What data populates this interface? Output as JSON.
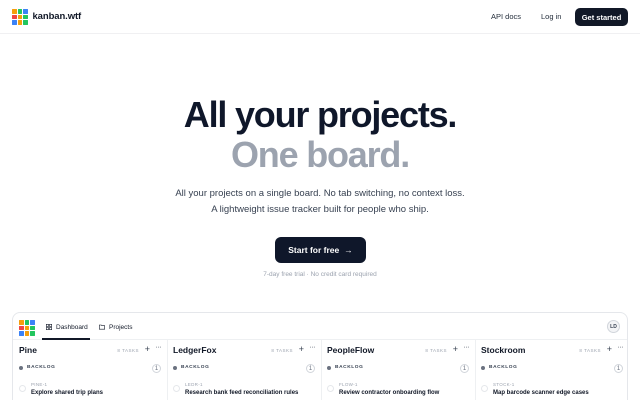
{
  "brand": {
    "name": "kanban.wtf",
    "logo_colors": [
      "#f59e0b",
      "#22c55e",
      "#3b82f6",
      "#ef4444",
      "#f59e0b",
      "#22c55e",
      "#3b82f6",
      "#f59e0b",
      "#22c55e"
    ]
  },
  "nav": {
    "api_docs": "API docs",
    "login": "Log in",
    "get_started": "Get started"
  },
  "hero": {
    "line1": "All your projects.",
    "line2": "One board.",
    "sub1": "All your projects on a single board. No tab switching, no context loss.",
    "sub2": "A lightweight issue tracker built for people who ship.",
    "cta_label": "Start for free",
    "cta_arrow": "→",
    "note": "7-day free trial · No credit card required"
  },
  "preview": {
    "tabs": [
      {
        "label": "Dashboard",
        "icon": "grid-icon"
      },
      {
        "label": "Projects",
        "icon": "folder-icon"
      }
    ],
    "avatar_initials": "LD",
    "columns": [
      {
        "title": "Pine",
        "count": "8 TASKS",
        "status": "BACKLOG",
        "status_count": "1",
        "task_id": "PINE-1",
        "task_title": "Explore shared trip plans"
      },
      {
        "title": "LedgerFox",
        "count": "8 TASKS",
        "status": "BACKLOG",
        "status_count": "1",
        "task_id": "LEDR-1",
        "task_title": "Research bank feed reconciliation rules"
      },
      {
        "title": "PeopleFlow",
        "count": "8 TASKS",
        "status": "BACKLOG",
        "status_count": "1",
        "task_id": "FLOW-1",
        "task_title": "Review contractor onboarding flow"
      },
      {
        "title": "Stockroom",
        "count": "8 TASKS",
        "status": "BACKLOG",
        "status_count": "1",
        "task_id": "STOCK-1",
        "task_title": "Map barcode scanner edge cases"
      }
    ],
    "plus": "+",
    "more": "···"
  }
}
